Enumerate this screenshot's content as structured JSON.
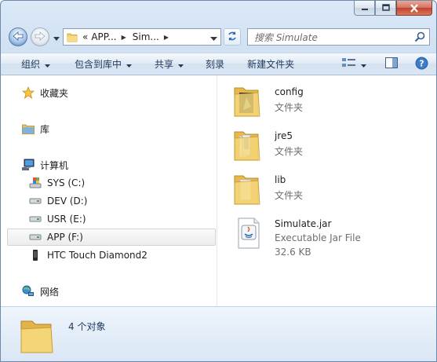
{
  "window": {
    "minimize_icon": "minimize-icon",
    "maximize_icon": "maximize-icon",
    "close_icon": "close-icon"
  },
  "address": {
    "overflow": "«",
    "crumbs": [
      "APP...",
      "Sim..."
    ],
    "search_placeholder": "搜索 Simulate"
  },
  "toolbar": {
    "organize": "组织",
    "include_in_library": "包含到库中",
    "share": "共享",
    "burn": "刻录",
    "new_folder": "新建文件夹"
  },
  "nav": {
    "favorites": "收藏夹",
    "libraries": "库",
    "computer": "计算机",
    "drives": [
      {
        "label": "SYS (C:)"
      },
      {
        "label": "DEV (D:)"
      },
      {
        "label": "USR (E:)"
      },
      {
        "label": "APP (F:)"
      }
    ],
    "device": "HTC Touch Diamond2",
    "network": "网络",
    "selected": "APP (F:)"
  },
  "files": [
    {
      "name": "config",
      "type": "文件夹",
      "icon": "folder-icon"
    },
    {
      "name": "jre5",
      "type": "文件夹",
      "icon": "folder-icon"
    },
    {
      "name": "lib",
      "type": "文件夹",
      "icon": "folder-icon"
    },
    {
      "name": "Simulate.jar",
      "type": "Executable Jar File",
      "size": "32.6 KB",
      "icon": "jar-file-icon"
    }
  ],
  "status": {
    "count": "4 个对象"
  },
  "colors": {
    "accent": "#1e395b",
    "frame": "#cfe0f2",
    "close": "#c4412c",
    "folder": "#f1cf6b"
  }
}
